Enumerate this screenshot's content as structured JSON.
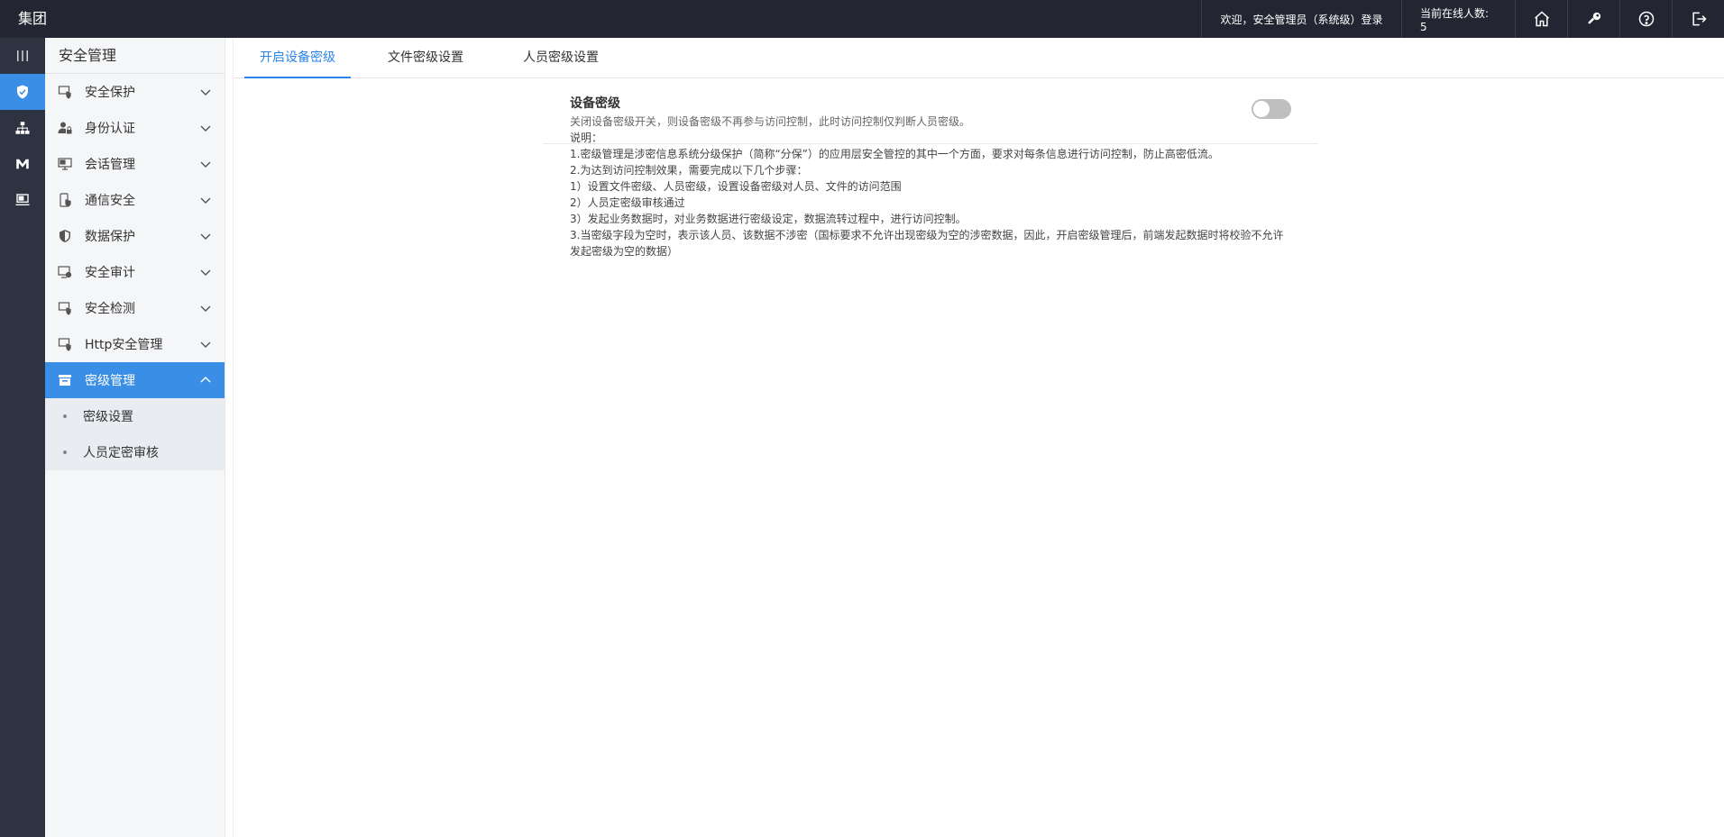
{
  "topbar": {
    "brand": "集团",
    "welcome": "欢迎，安全管理员（系统级）登录",
    "online": "当前在线人数: 5"
  },
  "rail": [
    "menu-toggle",
    "shield",
    "org-chart",
    "m-logo",
    "monitor"
  ],
  "sidebar": {
    "title": "安全管理",
    "items": [
      {
        "label": "安全保护"
      },
      {
        "label": "身份认证"
      },
      {
        "label": "会话管理"
      },
      {
        "label": "通信安全"
      },
      {
        "label": "数据保护"
      },
      {
        "label": "安全审计"
      },
      {
        "label": "安全检测"
      },
      {
        "label": "Http安全管理"
      },
      {
        "label": "密级管理"
      }
    ],
    "sub_items": [
      {
        "label": "密级设置"
      },
      {
        "label": "人员定密审核"
      }
    ]
  },
  "tabs": [
    {
      "label": "开启设备密级"
    },
    {
      "label": "文件密级设置"
    },
    {
      "label": "人员密级设置"
    }
  ],
  "setting": {
    "title": "设备密级",
    "desc": "关闭设备密级开关，则设备密级不再参与访问控制，此时访问控制仅判断人员密级。",
    "enabled": false
  },
  "notes": [
    "说明：",
    "1.密级管理是涉密信息系统分级保护（简称“分保”）的应用层安全管控的其中一个方面，要求对每条信息进行访问控制，防止高密低流。",
    "2.为达到访问控制效果，需要完成以下几个步骤：",
    "1）设置文件密级、人员密级，设置设备密级对人员、文件的访问范围",
    "2）人员定密级审核通过",
    "3）发起业务数据时，对业务数据进行密级设定，数据流转过程中，进行访问控制。",
    "3.当密级字段为空时，表示该人员、该数据不涉密（国标要求不允许出现密级为空的涉密数据，因此，开启密级管理后，前端发起数据时将校验不允许发起密级为空的数据）"
  ],
  "colors": {
    "topbar": "#232532",
    "rail": "#2d3340",
    "accent": "#3a8ee6"
  }
}
